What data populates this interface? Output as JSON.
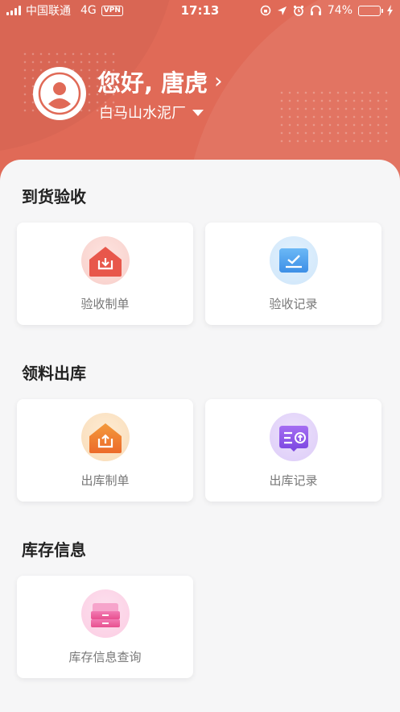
{
  "status_bar": {
    "carrier": "中国联通",
    "network": "4G",
    "vpn": "VPN",
    "time": "17:13",
    "battery": "74%",
    "battery_level": 0.74
  },
  "header": {
    "greeting": "您好, 唐虎",
    "chevron": "›",
    "company": "白马山水泥厂",
    "accent_color": "#e06a57"
  },
  "sections": [
    {
      "title": "到货验收",
      "cards": [
        {
          "label": "验收制单",
          "icon": "receive-house-icon"
        },
        {
          "label": "验收记录",
          "icon": "checklist-icon"
        }
      ]
    },
    {
      "title": "领料出库",
      "cards": [
        {
          "label": "出库制单",
          "icon": "outbound-house-icon"
        },
        {
          "label": "出库记录",
          "icon": "outbound-record-icon"
        }
      ]
    },
    {
      "title": "库存信息",
      "cards": [
        {
          "label": "库存信息查询",
          "icon": "drawer-icon"
        }
      ]
    }
  ]
}
